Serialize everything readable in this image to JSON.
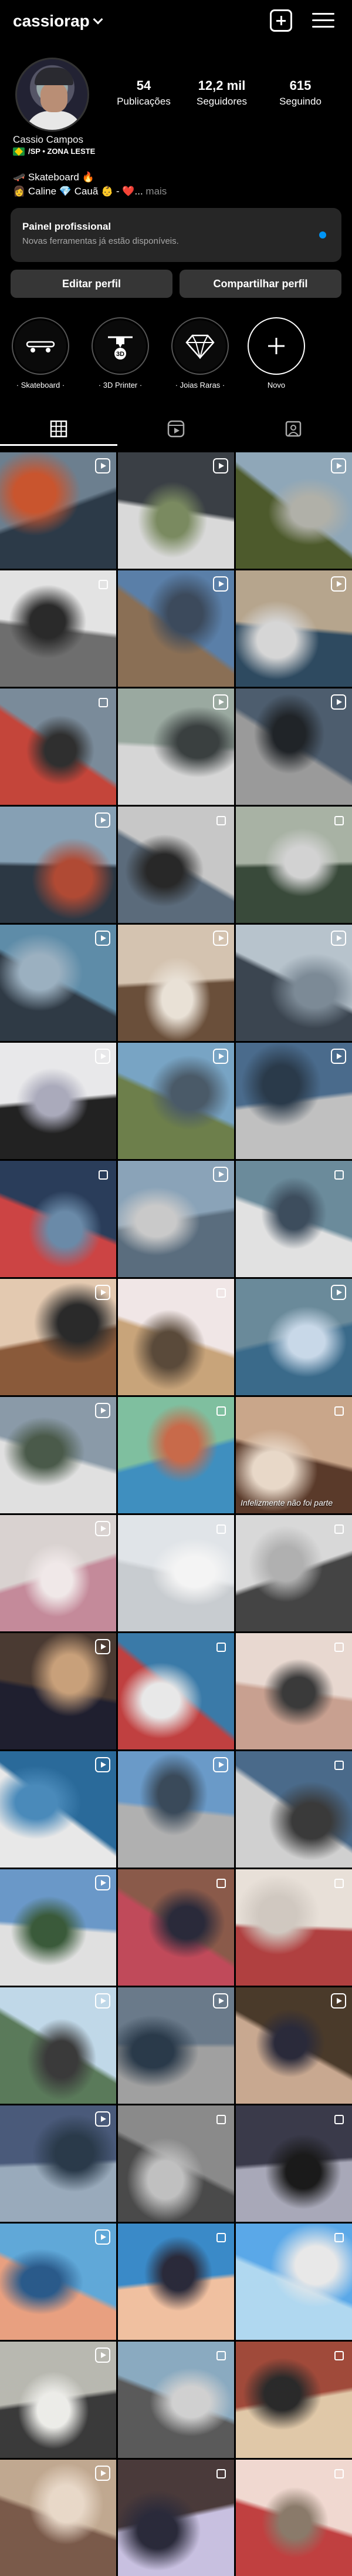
{
  "header": {
    "username": "cassiorap"
  },
  "profile": {
    "name": "Cassio Campos",
    "location": "/SP • ZONA LESTE",
    "bio_line1": "🛹 Skateboard 🔥",
    "bio_line2": "👩 Caline 💎 Cauã 👶 - ❤️...",
    "bio_more": " mais",
    "stats": [
      {
        "value": "54",
        "label": "Publicações"
      },
      {
        "value": "12,2 mil",
        "label": "Seguidores"
      },
      {
        "value": "615",
        "label": "Seguindo"
      }
    ]
  },
  "pro_panel": {
    "title": "Painel profissional",
    "subtitle": "Novas ferramentas já estão disponíveis."
  },
  "buttons": {
    "edit": "Editar perfil",
    "share": "Compartilhar perfil"
  },
  "highlights": [
    {
      "label": "Skateboard",
      "icon": "skateboard-icon"
    },
    {
      "label": "3D Printer",
      "icon": "printer-3d-icon"
    },
    {
      "label": "Joias Raras",
      "icon": "diamond-icon"
    },
    {
      "label": "Novo",
      "icon": "plus-icon"
    }
  ],
  "tabs": [
    {
      "name": "grid",
      "icon": "grid-icon",
      "active": true
    },
    {
      "name": "reels",
      "icon": "reels-icon",
      "active": false
    },
    {
      "name": "tagged",
      "icon": "tagged-icon",
      "active": false
    }
  ],
  "grid_overlay_text": {
    "cell_26": "Infelizmente não foi parte"
  },
  "colors": {
    "background": "#000000",
    "panel": "#262626",
    "button": "#363636",
    "accent": "#0095f6"
  }
}
